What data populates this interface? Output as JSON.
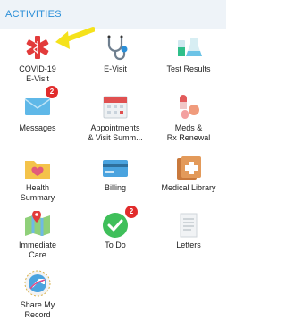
{
  "header": {
    "title": "ACTIVITIES"
  },
  "tiles": [
    {
      "label": "COVID-19\nE-Visit"
    },
    {
      "label": "E-Visit"
    },
    {
      "label": "Test Results"
    },
    {
      "label": "Messages",
      "badge": "2"
    },
    {
      "label": "Appointments\n& Visit Summ..."
    },
    {
      "label": "Meds &\nRx Renewal"
    },
    {
      "label": "Health\nSummary"
    },
    {
      "label": "Billing"
    },
    {
      "label": "Medical Library"
    },
    {
      "label": "Immediate\nCare"
    },
    {
      "label": "To Do",
      "badge": "2"
    },
    {
      "label": "Letters"
    },
    {
      "label": "Share My\nRecord"
    }
  ],
  "colors": {
    "accent": "#2b8fd8",
    "badge": "#e12b2b"
  }
}
